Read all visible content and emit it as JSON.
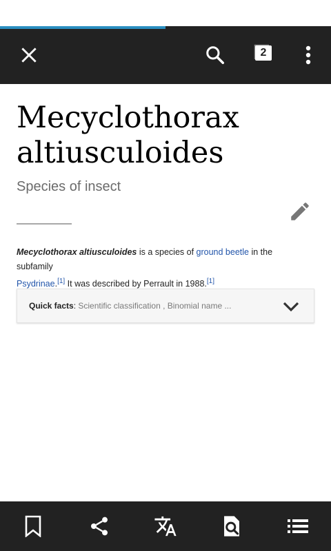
{
  "progress": {
    "fraction": 0.5
  },
  "toolbar": {
    "close_icon": "close-icon",
    "search_icon": "search-icon",
    "tabs_icon": "tabs-icon",
    "tabs_count": "2",
    "overflow_icon": "overflow-menu-icon"
  },
  "article": {
    "title": "Mecyclothorax altiusculoides",
    "subtitle": "Species of insect",
    "edit_icon": "pencil-icon",
    "lead": {
      "name": "Mecyclothorax altiusculoides",
      "t1": " is a species of ",
      "link1": "ground beetle",
      "t2": " in the subfamily ",
      "link2": "Psydrinae",
      "t3": ".",
      "ref1": "[1]",
      "t4": " It was described by Perrault in 1988.",
      "ref2": "[1]"
    },
    "quick_facts": {
      "label": "Quick facts",
      "sep": ": ",
      "summary": "Scientific classification , Binomial name ...",
      "icon": "chevron-down-icon"
    }
  },
  "bottom_bar": {
    "icons": [
      "bookmark-icon",
      "share-icon",
      "translate-icon",
      "find-in-page-icon",
      "table-of-contents-icon"
    ]
  },
  "colors": {
    "toolbar_bg": "#222222",
    "progress": "#2a8ec0",
    "link": "#2255aa"
  }
}
